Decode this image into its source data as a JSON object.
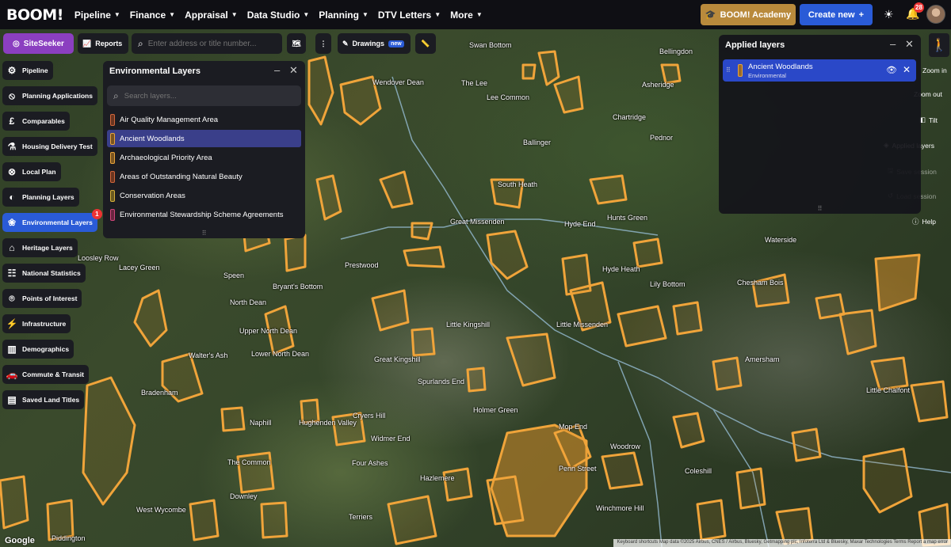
{
  "nav": {
    "logo": "BOOM!",
    "items": [
      {
        "label": "Pipeline"
      },
      {
        "label": "Finance"
      },
      {
        "label": "Appraisal"
      },
      {
        "label": "Data Studio"
      },
      {
        "label": "Planning"
      },
      {
        "label": "DTV Letters"
      },
      {
        "label": "More"
      }
    ],
    "academy_label": "BOOM! Academy",
    "create_label": "Create new",
    "notifications_count": "28"
  },
  "toolbar": {
    "siteseeker_label": "SiteSeeker",
    "reports_label": "Reports",
    "search_placeholder": "Enter address or title number...",
    "drawings_label": "Drawings",
    "new_badge": "new"
  },
  "sidebar": {
    "items": [
      {
        "label": "Pipeline",
        "icon": "pipeline-icon"
      },
      {
        "label": "Planning Applications",
        "icon": "planning-applications-icon"
      },
      {
        "label": "Comparables",
        "icon": "pound-icon"
      },
      {
        "label": "Housing Delivery Test",
        "icon": "flask-icon"
      },
      {
        "label": "Local Plan",
        "icon": "target-icon"
      },
      {
        "label": "Planning Layers",
        "icon": "planning-layers-icon"
      },
      {
        "label": "Environmental Layers",
        "icon": "environment-icon",
        "badge": "1"
      },
      {
        "label": "Heritage Layers",
        "icon": "heritage-icon"
      },
      {
        "label": "National Statistics",
        "icon": "statistics-icon"
      },
      {
        "label": "Points of Interest",
        "icon": "pin-icon"
      },
      {
        "label": "Infrastructure",
        "icon": "pylon-icon"
      },
      {
        "label": "Demographics",
        "icon": "chart-icon"
      },
      {
        "label": "Commute & Transit",
        "icon": "car-icon"
      },
      {
        "label": "Saved Land Titles",
        "icon": "folder-icon"
      }
    ]
  },
  "env_panel": {
    "title": "Environmental Layers",
    "search_placeholder": "Search layers...",
    "layers": [
      {
        "label": "Air Quality Management Area",
        "color": "#d0663a"
      },
      {
        "label": "Ancient Woodlands",
        "color": "#e8a33a"
      },
      {
        "label": "Archaeological Priority Area",
        "color": "#e8a33a"
      },
      {
        "label": "Areas of Outstanding Natural Beauty",
        "color": "#d0663a"
      },
      {
        "label": "Conservation Areas",
        "color": "#d8b03a"
      },
      {
        "label": "Environmental Stewardship Scheme Agreements",
        "color": "#d0457a"
      }
    ]
  },
  "applied_panel": {
    "title": "Applied layers",
    "items": [
      {
        "name": "Ancient Woodlands",
        "category": "Environmental"
      }
    ]
  },
  "map_controls": {
    "zoom_in": "Zoom in",
    "zoom_out": "Zoom out",
    "tilt": "Tilt",
    "applied_layers": "Applied layers",
    "save_session": "Save session",
    "load_session": "Load session",
    "help": "Help"
  },
  "places": [
    "Swan Bottom",
    "Bellingdon",
    "Wendover Dean",
    "The Lee",
    "Lee Common",
    "Asheridge",
    "Chartridge",
    "Ballinger",
    "Pednor",
    "South Heath",
    "Great Missenden",
    "Hyde End",
    "Hunts Green",
    "Prestwood",
    "Hyde Heath",
    "Lily Bottom",
    "Speen",
    "Bryant's Bottom",
    "North Dean",
    "Lacey Green",
    "Loosley Row",
    "Little Kingshill",
    "Little Missenden",
    "Upper North Dean",
    "Lower North Dean",
    "Great Kingshill",
    "Walter's Ash",
    "Bradenham",
    "Naphill",
    "Spurlands End",
    "Holmer Green",
    "Cryers Hill",
    "Hughenden Valley",
    "Widmer End",
    "Four Ashes",
    "Hazlemere",
    "Penn Street",
    "Mop End",
    "Woodrow",
    "Coleshill",
    "Amersham",
    "Little Chalfont",
    "Chesham Bois",
    "The Common",
    "Downley",
    "West Wycombe",
    "Piddington",
    "Winchmore Hill",
    "Terriers",
    "Waterside"
  ],
  "map_footer": {
    "google": "Google",
    "attribution": "Keyboard shortcuts  Map data ©2025 Airbus, CNES / Airbus, Bluesky, Getmapping plc, Infoterra Ltd & Bluesky, Maxar Technologies  Terms  Report a map error"
  },
  "colors": {
    "accent_blue": "#2a5bd7",
    "siteseeker_purple": "#8b3fc0",
    "woodland_orange": "#e8a33a"
  }
}
